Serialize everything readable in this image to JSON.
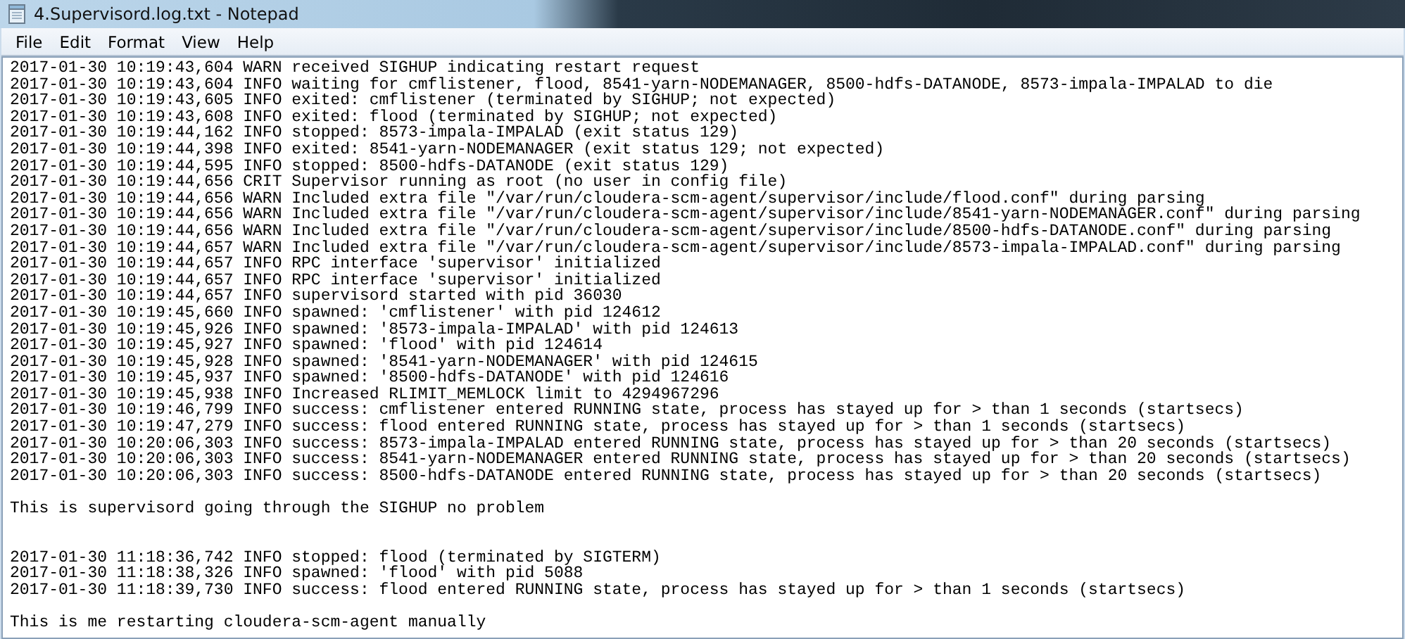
{
  "window": {
    "title": "4.Supervisord.log.txt - Notepad"
  },
  "menu": [
    "File",
    "Edit",
    "Format",
    "View",
    "Help"
  ],
  "document": {
    "lines": [
      {
        "kind": "text",
        "text": "2017-01-30 10:19:43,604 WARN received SIGHUP indicating restart request"
      },
      {
        "kind": "text",
        "text": "2017-01-30 10:19:43,604 INFO waiting for cmflistener, flood, 8541-yarn-NODEMANAGER, 8500-hdfs-DATANODE, 8573-impala-IMPALAD to die"
      },
      {
        "kind": "text",
        "text": "2017-01-30 10:19:43,605 INFO exited: cmflistener (terminated by SIGHUP; not expected)"
      },
      {
        "kind": "text",
        "text": "2017-01-30 10:19:43,608 INFO exited: flood (terminated by SIGHUP; not expected)"
      },
      {
        "kind": "text",
        "text": "2017-01-30 10:19:44,162 INFO stopped: 8573-impala-IMPALAD (exit status 129)"
      },
      {
        "kind": "text",
        "text": "2017-01-30 10:19:44,398 INFO exited: 8541-yarn-NODEMANAGER (exit status 129; not expected)"
      },
      {
        "kind": "text",
        "text": "2017-01-30 10:19:44,595 INFO stopped: 8500-hdfs-DATANODE (exit status 129)"
      },
      {
        "kind": "text",
        "text": "2017-01-30 10:19:44,656 CRIT Supervisor running as root (no user in config file)"
      },
      {
        "kind": "text",
        "text": "2017-01-30 10:19:44,656 WARN Included extra file \"/var/run/cloudera-scm-agent/supervisor/include/flood.conf\" during parsing"
      },
      {
        "kind": "text",
        "text": "2017-01-30 10:19:44,656 WARN Included extra file \"/var/run/cloudera-scm-agent/supervisor/include/8541-yarn-NODEMANAGER.conf\" during parsing"
      },
      {
        "kind": "text",
        "text": "2017-01-30 10:19:44,656 WARN Included extra file \"/var/run/cloudera-scm-agent/supervisor/include/8500-hdfs-DATANODE.conf\" during parsing"
      },
      {
        "kind": "text",
        "text": "2017-01-30 10:19:44,657 WARN Included extra file \"/var/run/cloudera-scm-agent/supervisor/include/8573-impala-IMPALAD.conf\" during parsing"
      },
      {
        "kind": "text",
        "text": "2017-01-30 10:19:44,657 INFO RPC interface 'supervisor' initialized"
      },
      {
        "kind": "text",
        "text": "2017-01-30 10:19:44,657 INFO RPC interface 'supervisor' initialized"
      },
      {
        "kind": "text",
        "text": "2017-01-30 10:19:44,657 INFO supervisord started with pid 36030"
      },
      {
        "kind": "text",
        "text": "2017-01-30 10:19:45,660 INFO spawned: 'cmflistener' with pid 124612"
      },
      {
        "kind": "text",
        "text": "2017-01-30 10:19:45,926 INFO spawned: '8573-impala-IMPALAD' with pid 124613"
      },
      {
        "kind": "text",
        "text": "2017-01-30 10:19:45,927 INFO spawned: 'flood' with pid 124614"
      },
      {
        "kind": "text",
        "text": "2017-01-30 10:19:45,928 INFO spawned: '8541-yarn-NODEMANAGER' with pid 124615"
      },
      {
        "kind": "text",
        "text": "2017-01-30 10:19:45,937 INFO spawned: '8500-hdfs-DATANODE' with pid 124616"
      },
      {
        "kind": "text",
        "text": "2017-01-30 10:19:45,938 INFO Increased RLIMIT_MEMLOCK limit to 4294967296"
      },
      {
        "kind": "text",
        "text": "2017-01-30 10:19:46,799 INFO success: cmflistener entered RUNNING state, process has stayed up for > than 1 seconds (startsecs)"
      },
      {
        "kind": "text",
        "text": "2017-01-30 10:19:47,279 INFO success: flood entered RUNNING state, process has stayed up for > than 1 seconds (startsecs)"
      },
      {
        "kind": "text",
        "text": "2017-01-30 10:20:06,303 INFO success: 8573-impala-IMPALAD entered RUNNING state, process has stayed up for > than 20 seconds (startsecs)"
      },
      {
        "kind": "text",
        "text": "2017-01-30 10:20:06,303 INFO success: 8541-yarn-NODEMANAGER entered RUNNING state, process has stayed up for > than 20 seconds (startsecs)"
      },
      {
        "kind": "text",
        "text": "2017-01-30 10:20:06,303 INFO success: 8500-hdfs-DATANODE entered RUNNING state, process has stayed up for > than 20 seconds (startsecs)"
      },
      {
        "kind": "blank"
      },
      {
        "kind": "text",
        "text": "This is supervisord going through the SIGHUP no problem"
      },
      {
        "kind": "blank"
      },
      {
        "kind": "blank"
      },
      {
        "kind": "text",
        "text": "2017-01-30 11:18:36,742 INFO stopped: flood (terminated by SIGTERM)"
      },
      {
        "kind": "text",
        "text": "2017-01-30 11:18:38,326 INFO spawned: 'flood' with pid 5088"
      },
      {
        "kind": "text",
        "text": "2017-01-30 11:18:39,730 INFO success: flood entered RUNNING state, process has stayed up for > than 1 seconds (startsecs)"
      },
      {
        "kind": "blank"
      },
      {
        "kind": "text",
        "text": "This is me restarting cloudera-scm-agent manually"
      }
    ]
  }
}
